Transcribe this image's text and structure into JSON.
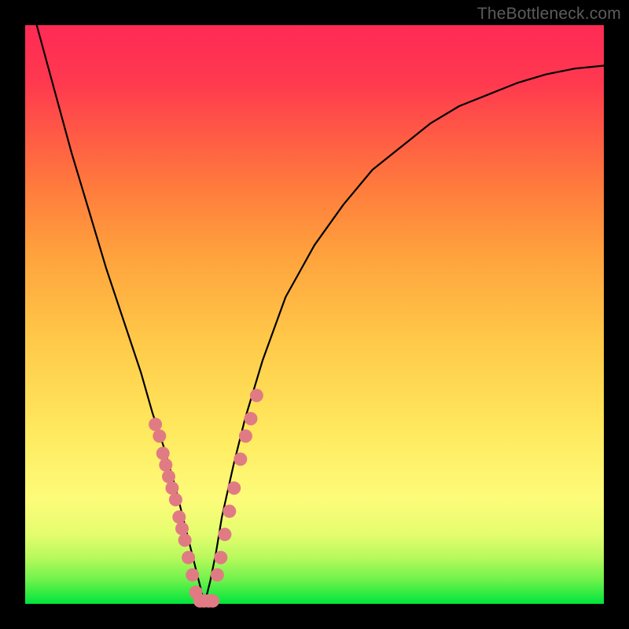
{
  "watermark": "TheBottleneck.com",
  "chart_data": {
    "type": "line",
    "title": "",
    "xlabel": "",
    "ylabel": "",
    "xlim": [
      0,
      100
    ],
    "ylim": [
      0,
      100
    ],
    "grid": false,
    "series": [
      {
        "name": "bottleneck-curve",
        "x": [
          2,
          5,
          8,
          11,
          14,
          17,
          20,
          22,
          24,
          26,
          27,
          28,
          29,
          30,
          31,
          32,
          33,
          34,
          36,
          38,
          41,
          45,
          50,
          55,
          60,
          65,
          70,
          75,
          80,
          85,
          90,
          95,
          100
        ],
        "values": [
          100,
          89,
          78,
          68,
          58,
          49,
          40,
          33,
          27,
          20,
          16,
          12,
          8,
          4,
          0,
          4,
          9,
          15,
          24,
          32,
          42,
          53,
          62,
          69,
          75,
          79,
          83,
          86,
          88,
          90,
          91.5,
          92.5,
          93
        ]
      }
    ],
    "dots": {
      "name": "sample-points",
      "color": "#e07b84",
      "left_branch": {
        "x": [
          22.5,
          23.2,
          23.8,
          24.3,
          24.8,
          25.4,
          26.0,
          26.6,
          27.1,
          27.6,
          28.2,
          28.9,
          29.5
        ],
        "values": [
          31,
          29,
          26,
          24,
          22,
          20,
          18,
          15,
          13,
          11,
          8,
          5,
          2
        ]
      },
      "valley": {
        "x": [
          30.2,
          30.9,
          31.7,
          32.4
        ],
        "values": [
          0.5,
          0.5,
          0.5,
          0.5
        ]
      },
      "right_branch": {
        "x": [
          33.2,
          33.8,
          34.5,
          35.3,
          36.1,
          37.2,
          38.1,
          39.0,
          40.0
        ],
        "values": [
          5,
          8,
          12,
          16,
          20,
          25,
          29,
          32,
          36
        ]
      }
    }
  }
}
